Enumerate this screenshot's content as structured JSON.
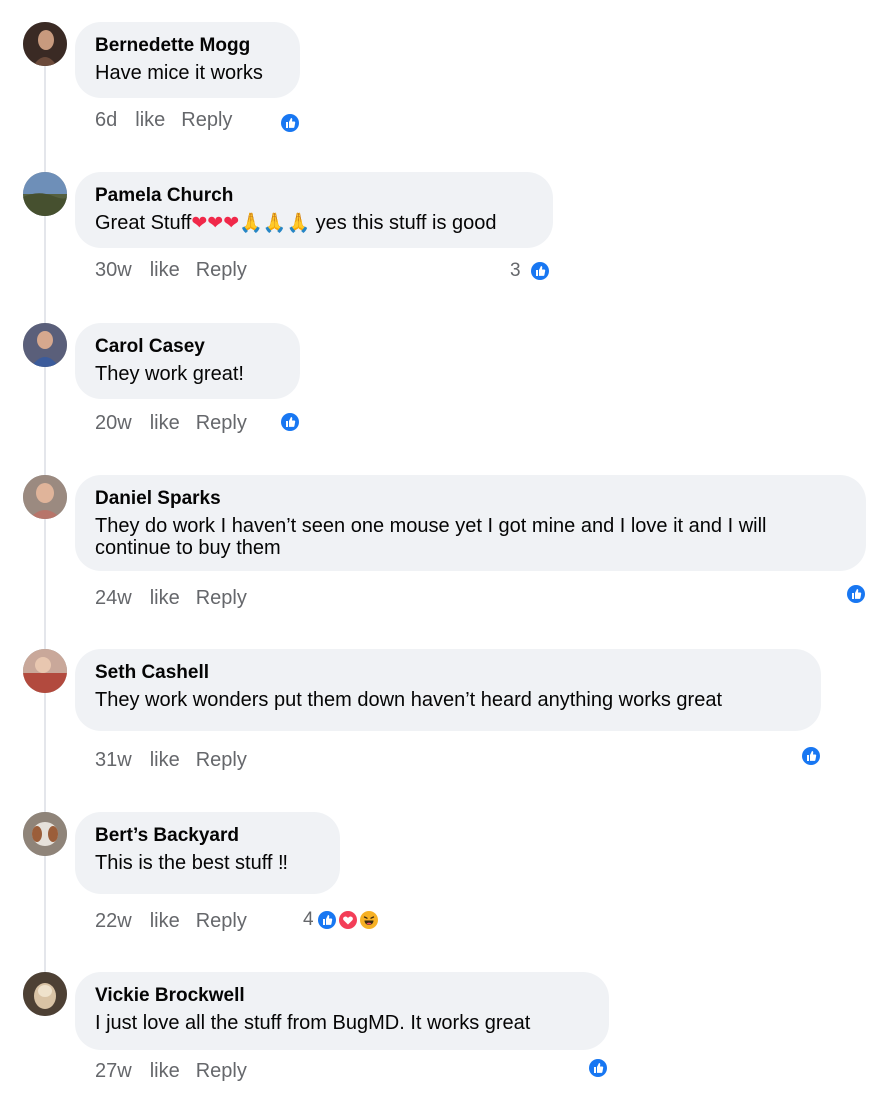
{
  "actions": {
    "like": "like",
    "reply": "Reply"
  },
  "colors": {
    "like_blue": "#1877f2",
    "love_red": "#f33e58",
    "haha_yellow": "#f7b125",
    "bubble_bg": "#f0f2f5",
    "meta_gray": "#65676b"
  },
  "comments": [
    {
      "author": "Bernedette Mogg",
      "text": "Have mice it works",
      "time": "6d",
      "reaction_count": "",
      "reactions": [
        "like-icon"
      ]
    },
    {
      "author": "Pamela Church",
      "text_before": "Great Stuff",
      "hearts": "❤❤❤",
      "prays": "🙏🙏🙏",
      "text_after": " yes this stuff is good",
      "time": "30w",
      "reaction_count": "3",
      "reactions": [
        "like-icon"
      ]
    },
    {
      "author": "Carol Casey",
      "text": "They work great!",
      "time": "20w",
      "reaction_count": "",
      "reactions": [
        "like-icon"
      ]
    },
    {
      "author": "Daniel Sparks",
      "text": "They do work I haven’t seen one mouse yet I got mine and I love it and I will continue to buy them",
      "time": "24w",
      "reaction_count": "",
      "reactions": [
        "like-icon"
      ]
    },
    {
      "author": "Seth Cashell",
      "text": "They work wonders put them down haven’t heard anything works great",
      "time": "31w",
      "reaction_count": "",
      "reactions": [
        "like-icon"
      ]
    },
    {
      "author": "Bert’s Backyard",
      "text": "This is the best stuff ‼",
      "time": "22w",
      "reaction_count": "4",
      "reactions": [
        "like-icon",
        "love-icon",
        "haha-icon"
      ]
    },
    {
      "author": "Vickie Brockwell",
      "text": "I just love all the stuff from BugMD. It works great",
      "time": "27w",
      "reaction_count": "",
      "reactions": [
        "like-icon"
      ]
    }
  ]
}
